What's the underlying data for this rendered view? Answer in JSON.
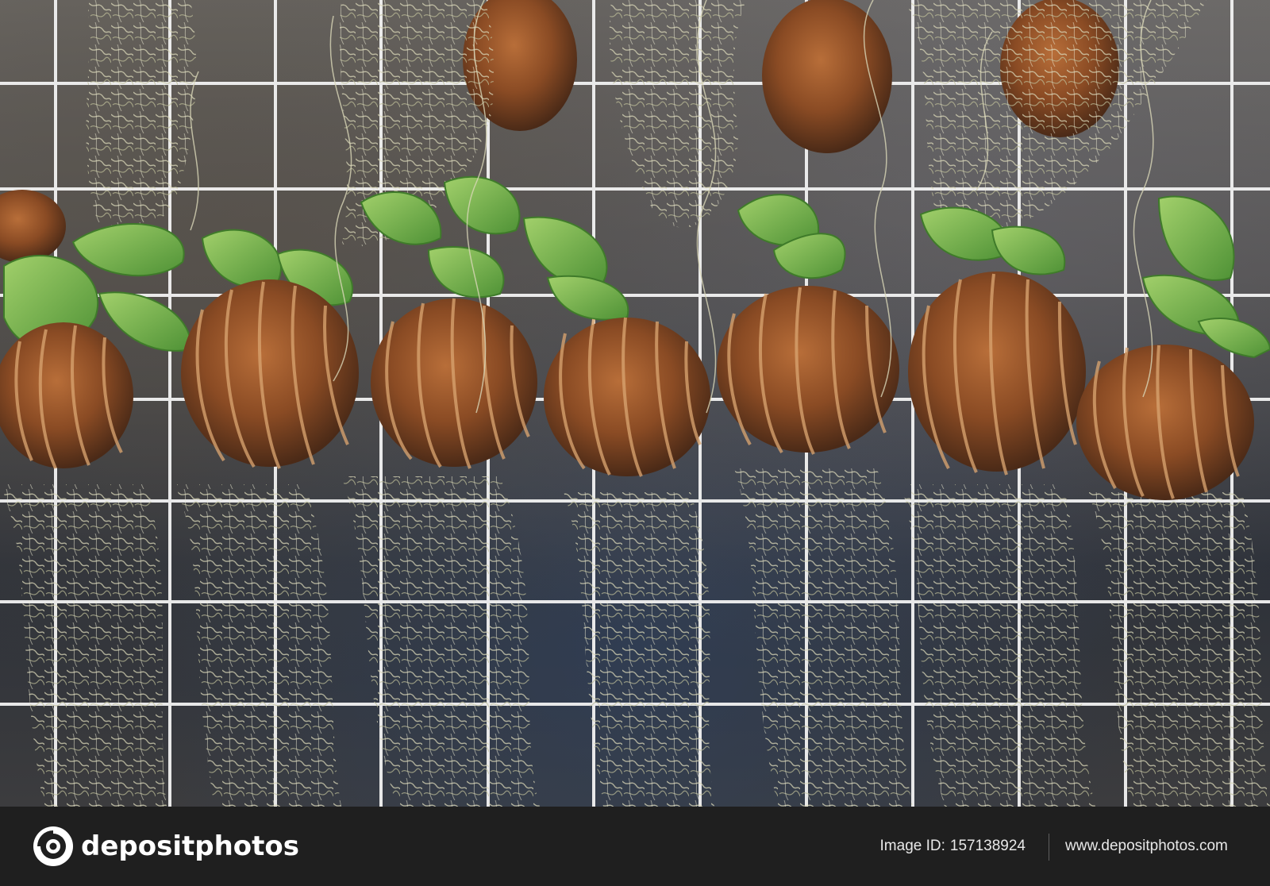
{
  "photo": {
    "subject": "coconut-shell air plants with Spanish moss",
    "icon": "photo-scene"
  },
  "footer": {
    "logo_text": "depositphotos",
    "image_id_label": "Image ID:",
    "image_id_value": "157138924",
    "site_url": "www.depositphotos.com",
    "logo_icon": "camera-aperture-icon"
  },
  "colors": {
    "footer_background": "#1f1f1f",
    "text": "#ffffff",
    "shell": "#8a4b24",
    "shell_stripe": "#d6a06b",
    "leaf": "#78b84b",
    "moss": "#c9c8a4",
    "grid": "#f1f1f1"
  }
}
